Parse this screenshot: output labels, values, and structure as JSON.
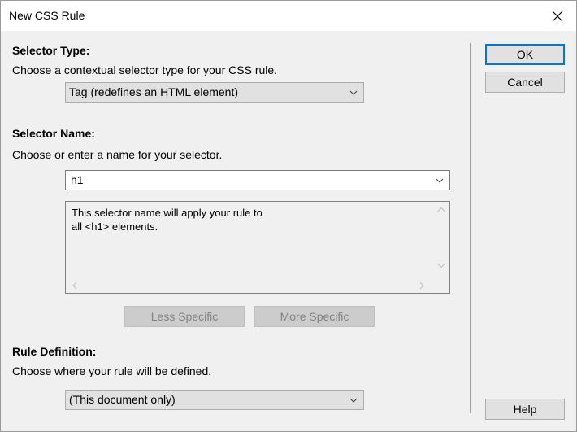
{
  "window": {
    "title": "New CSS Rule"
  },
  "selector_type": {
    "heading": "Selector Type:",
    "description": "Choose a contextual selector type for your CSS rule.",
    "selected": "Tag (redefines an HTML element)"
  },
  "selector_name": {
    "heading": "Selector Name:",
    "description": "Choose or enter a name for your selector.",
    "value": "h1",
    "info_text": "This selector name will apply your rule to\nall <h1> elements."
  },
  "specificity": {
    "less_label": "Less Specific",
    "more_label": "More Specific"
  },
  "rule_definition": {
    "heading": "Rule Definition:",
    "description": "Choose where your rule will be defined.",
    "selected": "(This document only)"
  },
  "buttons": {
    "ok_label": "OK",
    "cancel_label": "Cancel",
    "help_label": "Help"
  },
  "icons": {
    "close": "close-icon",
    "chevron": "chevron-down-icon",
    "scroll_up": "chevron-up-icon",
    "scroll_down": "chevron-down-icon",
    "scroll_left": "chevron-left-icon",
    "scroll_right": "chevron-right-icon"
  },
  "colors": {
    "default_button_border": "#0078d7",
    "dialog_background": "#f0f0f0",
    "disabled_text": "#838383"
  }
}
